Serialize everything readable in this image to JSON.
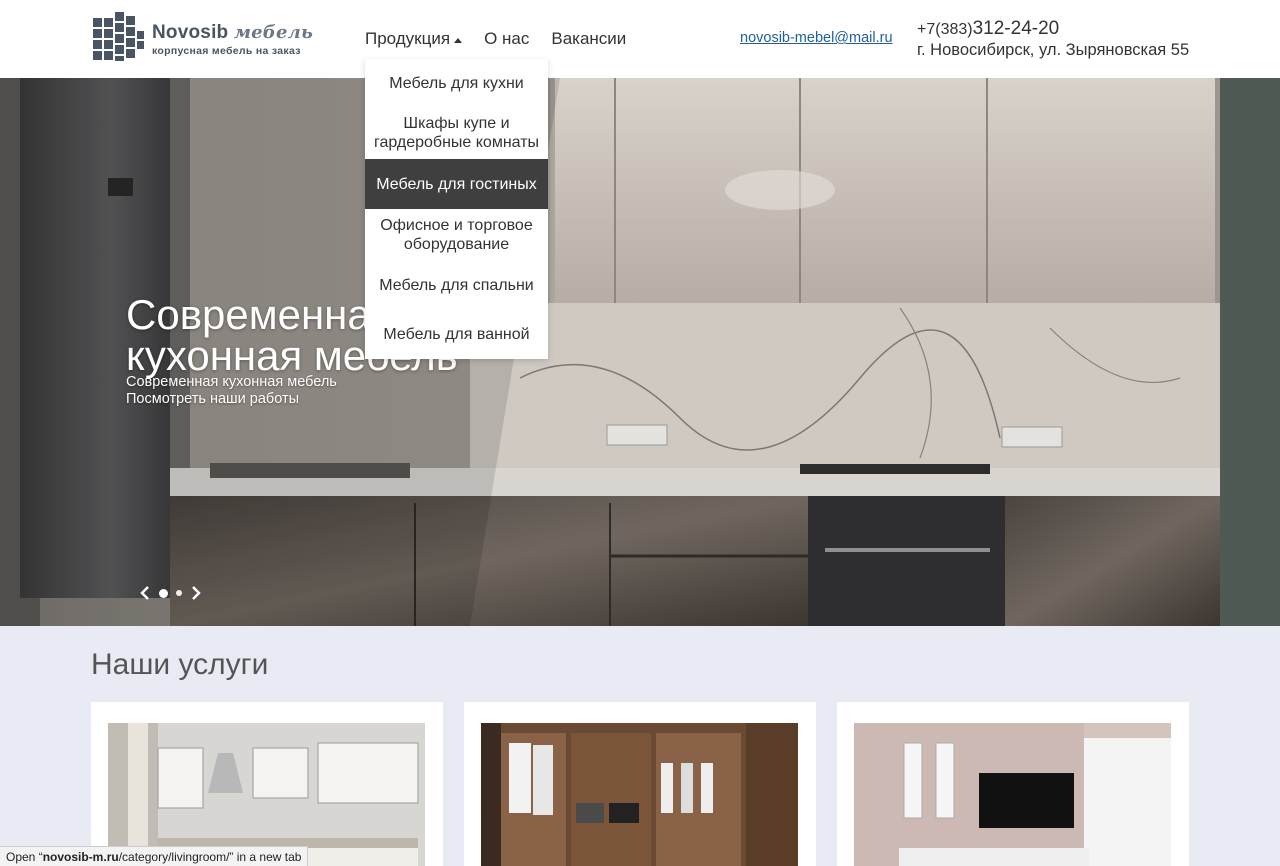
{
  "header": {
    "logo_title": "Novosib",
    "logo_title_suffix": "мебель",
    "logo_subtitle": "корпусная мебель на заказ",
    "nav": [
      {
        "label": "Продукция"
      },
      {
        "label": "О нас"
      },
      {
        "label": "Вакансии"
      }
    ],
    "email": "novosib-mebel@mail.ru",
    "phone_prefix": "+7(383)",
    "phone_number": "312-24-20",
    "address": "г. Новосибирск, ул. Зыряновская 55"
  },
  "dropdown": {
    "items": [
      {
        "label": "Мебель для кухни"
      },
      {
        "label": "Шкафы купе и гардеробные комнаты"
      },
      {
        "label": "Мебель для гостиных"
      },
      {
        "label": "Офисное и торговое оборудование"
      },
      {
        "label": "Мебель для спальни"
      },
      {
        "label": "Мебель для ванной"
      }
    ],
    "active_index": 2
  },
  "hero": {
    "title": "Современная кухонная мебель",
    "subtitle": "Современная кухонная мебель",
    "link": "Посмотреть наши работы"
  },
  "services": {
    "title": "Наши услуги"
  },
  "status_bar": {
    "prefix": "Open “",
    "url_bold": "novosib-m.ru",
    "url_rest": "/category/livingroom/",
    "suffix": "” in a new tab"
  },
  "colors": {
    "accent_link": "#1f5f9c",
    "dropdown_active": "#3f3f3f",
    "page_bg": "#e8ebf3"
  }
}
